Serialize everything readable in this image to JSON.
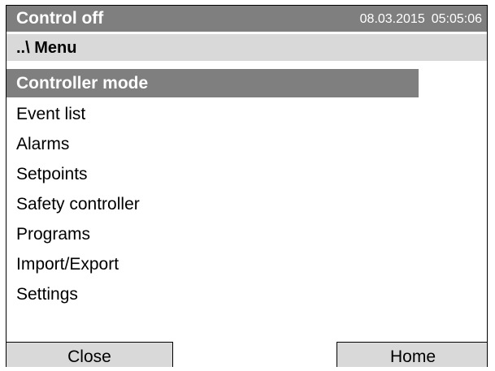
{
  "header": {
    "title": "Control off",
    "date": "08.03.2015",
    "time": "05:05:06"
  },
  "breadcrumb": "..\\ Menu",
  "menu": {
    "items": [
      {
        "label": "Controller mode",
        "selected": true
      },
      {
        "label": "Event list"
      },
      {
        "label": "Alarms"
      },
      {
        "label": "Setpoints"
      },
      {
        "label": "Safety controller"
      },
      {
        "label": "Programs"
      },
      {
        "label": "Import/Export"
      },
      {
        "label": "Settings"
      }
    ]
  },
  "footer": {
    "close_label": "Close",
    "home_label": "Home"
  },
  "colors": {
    "title_bg": "#7f7f7f",
    "breadcrumb_bg": "#d9d9d9",
    "selected_bg": "#7f7f7f",
    "button_bg": "#d9d9d9"
  }
}
